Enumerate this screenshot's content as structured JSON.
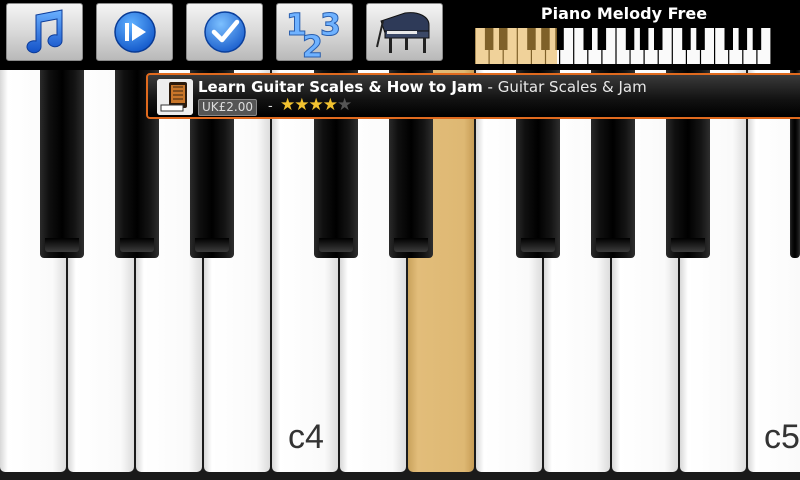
{
  "app": {
    "title": "Piano Melody Free"
  },
  "toolbar": {
    "buttons": [
      {
        "icon": "music-note-icon"
      },
      {
        "icon": "play-icon"
      },
      {
        "icon": "checkmark-icon"
      },
      {
        "icon": "numbers-123-icon"
      },
      {
        "icon": "grand-piano-icon"
      }
    ],
    "mini_keyboard": {
      "highlight_color": "#e8b04a"
    }
  },
  "ad": {
    "title": "Learn Guitar Scales & How to Jam",
    "separator": "-",
    "subtitle": "Guitar Scales & Jam",
    "price": "UK£2.00",
    "dash": "-",
    "rating_stars": 4,
    "rating_max": 5,
    "border_color": "#e06a1e"
  },
  "piano": {
    "pressed_color": "#deb873",
    "labels": {
      "c4": "c4",
      "c5": "c5"
    }
  }
}
